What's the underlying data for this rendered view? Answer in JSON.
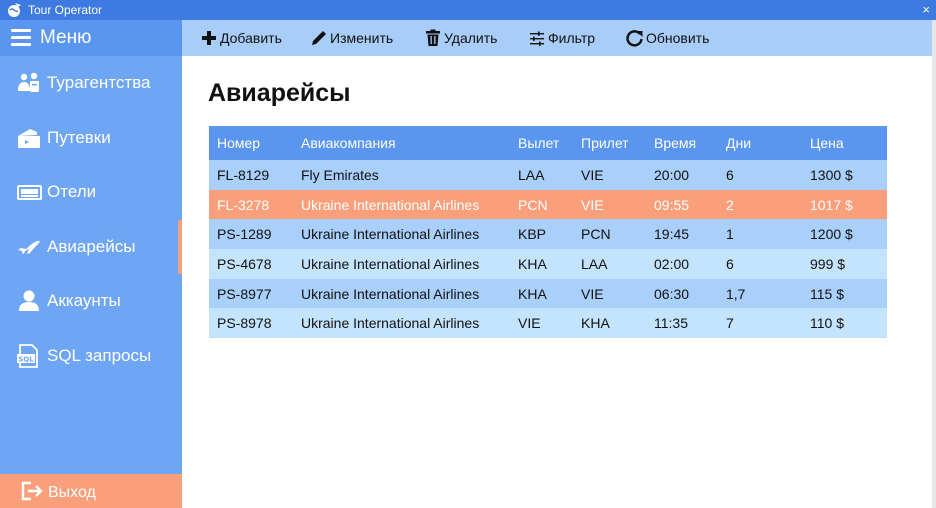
{
  "window": {
    "title": "Tour Operator",
    "close_glyph": "×"
  },
  "sidebar": {
    "menu_label": "Меню",
    "items": [
      {
        "label": "Турагентства",
        "icon": "agents-icon"
      },
      {
        "label": "Путевки",
        "icon": "ticket-icon"
      },
      {
        "label": "Отели",
        "icon": "hotel-icon"
      },
      {
        "label": "Авиарейсы",
        "icon": "airplane-icon",
        "active": true
      },
      {
        "label": "Аккаунты",
        "icon": "user-icon"
      },
      {
        "label": "SQL запросы",
        "icon": "sql-icon"
      }
    ],
    "logout_label": "Выход"
  },
  "toolbar": {
    "add": "Добавить",
    "edit": "Изменить",
    "delete": "Удалить",
    "filter": "Фильтр",
    "refresh": "Обновить"
  },
  "main": {
    "title": "Авиарейсы",
    "table": {
      "headers": [
        "Номер",
        "Авиакомпания",
        "Вылет",
        "Прилет",
        "Время",
        "Дни",
        "Цена"
      ],
      "selected_row": 1,
      "rows": [
        [
          "FL-8129",
          "Fly Emirates",
          "LAA",
          "VIE",
          "20:00",
          "6",
          "1300 $"
        ],
        [
          "FL-3278",
          "Ukraine International Airlines",
          "PCN",
          "VIE",
          "09:55",
          "2",
          "1017 $"
        ],
        [
          "PS-1289",
          "Ukraine International Airlines",
          "KBP",
          "PCN",
          "19:45",
          "1",
          "1200 $"
        ],
        [
          "PS-4678",
          "Ukraine International Airlines",
          "KHA",
          "LAA",
          "02:00",
          "6",
          "999 $"
        ],
        [
          "PS-8977",
          "Ukraine International Airlines",
          "KHA",
          "VIE",
          "06:30",
          "1,7",
          "115 $"
        ],
        [
          "PS-8978",
          "Ukraine International Airlines",
          "VIE",
          "KHA",
          "11:35",
          "7",
          "110 $"
        ]
      ]
    }
  },
  "colors": {
    "titlebar": "#3d7be0",
    "sidebar": "#6fa6f4",
    "toolbar": "#a7cdf8",
    "header_row": "#5a96ef",
    "selected_row": "#fa9f7b",
    "row_odd": "#a9d0fa",
    "row_even": "#c4e4fd"
  }
}
